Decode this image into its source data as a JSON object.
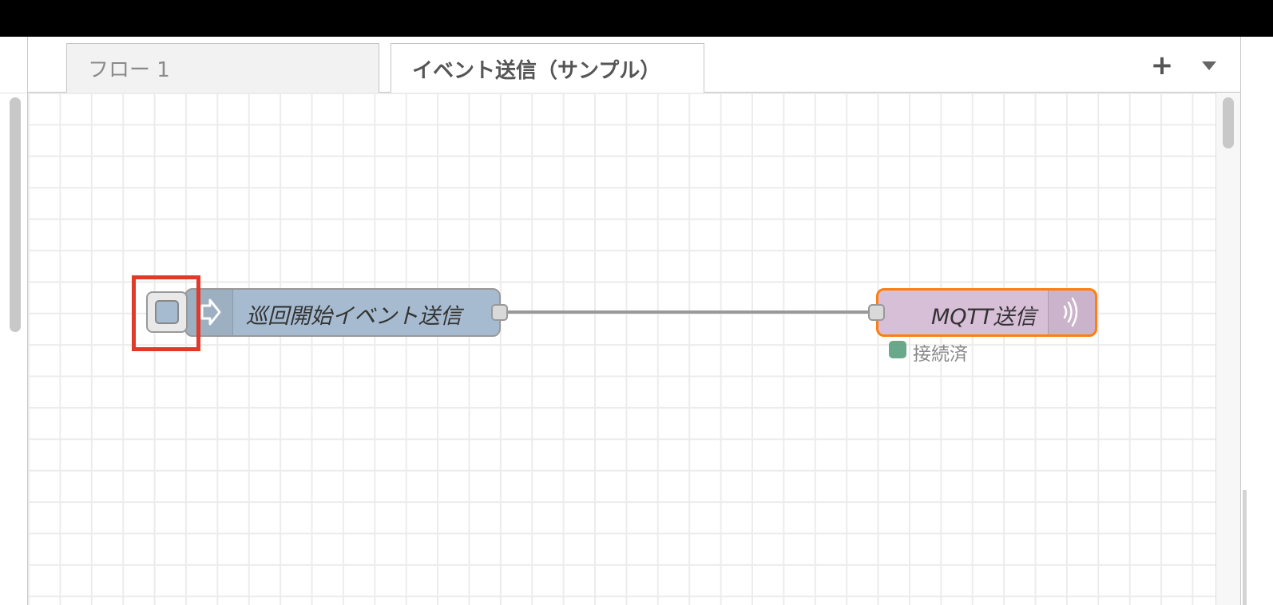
{
  "tabs": [
    {
      "label": "フロー 1",
      "active": false
    },
    {
      "label": "イベント送信（サンプル）",
      "active": true
    }
  ],
  "tab_actions": {
    "add_icon": "plus-icon",
    "add_label": "+",
    "menu_icon": "caret-down-icon"
  },
  "nodes": {
    "inject": {
      "label": "巡回開始イベント送信",
      "icon": "arrow-right-icon",
      "color": "#a6bbcf"
    },
    "mqtt": {
      "label": "MQTT送信",
      "icon": "broadcast-icon",
      "color": "#d8bfd8",
      "status": "接続済",
      "status_color": "#5a9e7e",
      "selected_border": "#ff7f0e"
    }
  },
  "highlight_color": "#e13a2b"
}
